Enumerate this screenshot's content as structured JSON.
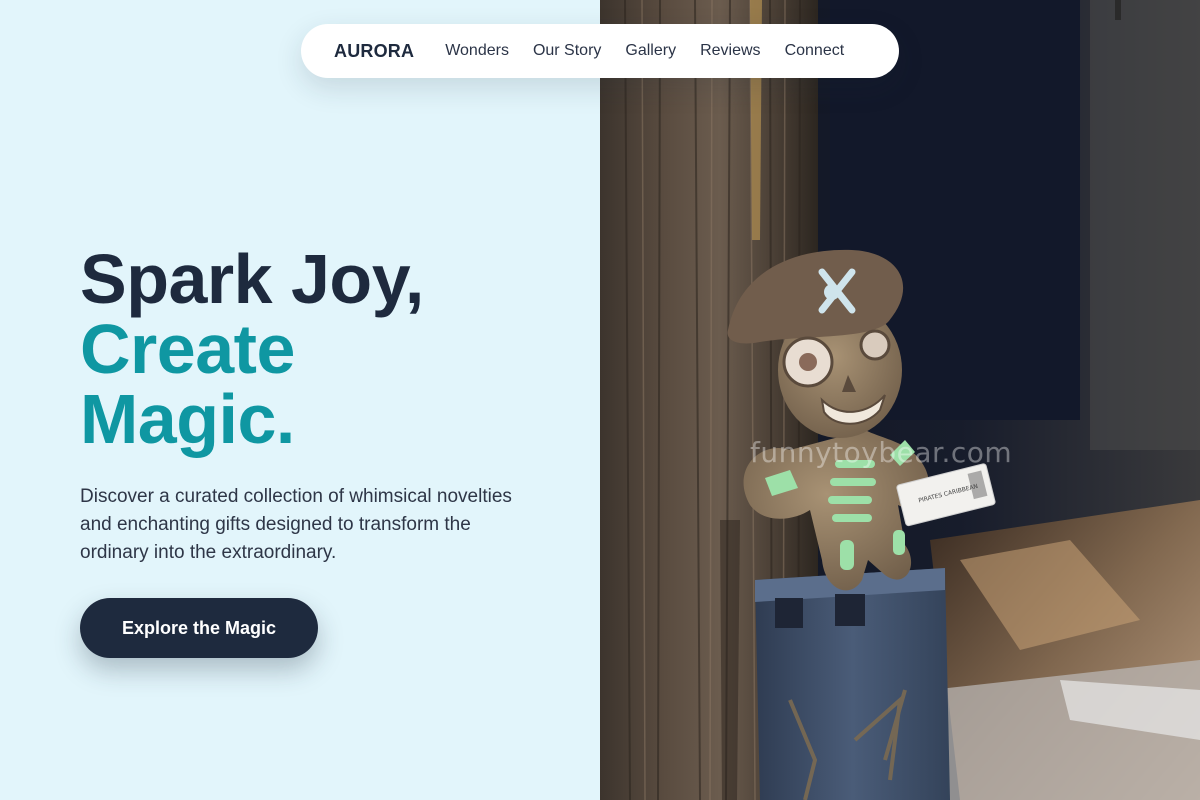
{
  "nav": {
    "brand": "AURORA",
    "links": [
      "Wonders",
      "Our Story",
      "Gallery",
      "Reviews",
      "Connect"
    ]
  },
  "hero": {
    "title_line1": "Spark Joy,",
    "title_line2": "Create",
    "title_line3": "Magic.",
    "description": "Discover a curated collection of whimsical novelties and enchanting gifts designed to transform the ordinary into the extraordinary.",
    "cta_label": "Explore the Magic"
  },
  "photo": {
    "watermark": "funnytoybear.com",
    "tag_text": "PIRATES CARIBBEAN"
  },
  "colors": {
    "background": "#e2f5fb",
    "navy": "#1e2a3e",
    "teal": "#0f97a2"
  }
}
